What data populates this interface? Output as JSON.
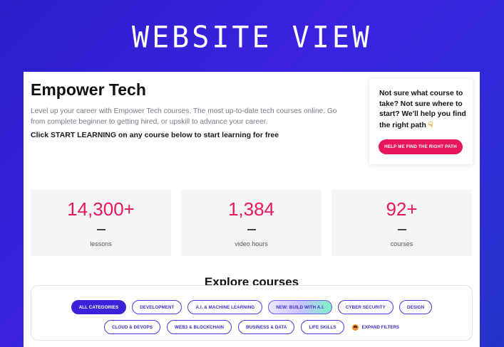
{
  "banner": {
    "title": "WEBSITE VIEW"
  },
  "hero": {
    "title": "Empower Tech",
    "description": "Level up your career with Empower Tech courses. The most up-to-date tech courses online. Go from complete beginner to getting hired, or upskill to advance your career.",
    "cta": "Click START LEARNING on any course below to start learning for free"
  },
  "help": {
    "text": "Not sure what course to take? Not sure where to start? We'll help you find the right path",
    "icon": "pointing-hand-icon",
    "button_label": "HELP ME FIND THE RIGHT PATH"
  },
  "stats": [
    {
      "value": "14,300+",
      "label": "lessons"
    },
    {
      "value": "1,384",
      "label": "video hours"
    },
    {
      "value": "92+",
      "label": "courses"
    }
  ],
  "explore": {
    "title": "Explore courses",
    "row1": [
      "ALL CATEGORIES",
      "DEVELOPMENT",
      "A.I. & MACHINE LEARNING",
      "NEW: BUILD WITH A.I.",
      "CYBER SECURITY",
      "DESIGN"
    ],
    "row2": [
      "CLOUD & DEVOPS",
      "WEB3 & BLOCKCHAIN",
      "BUSINESS & DATA",
      "LIFE SKILLS"
    ],
    "expand_label": "EXPAND FILTERS",
    "expand_icon": "filter-emoji-icon"
  },
  "colors": {
    "accent": "#e8175d",
    "brand": "#3a22d8"
  }
}
